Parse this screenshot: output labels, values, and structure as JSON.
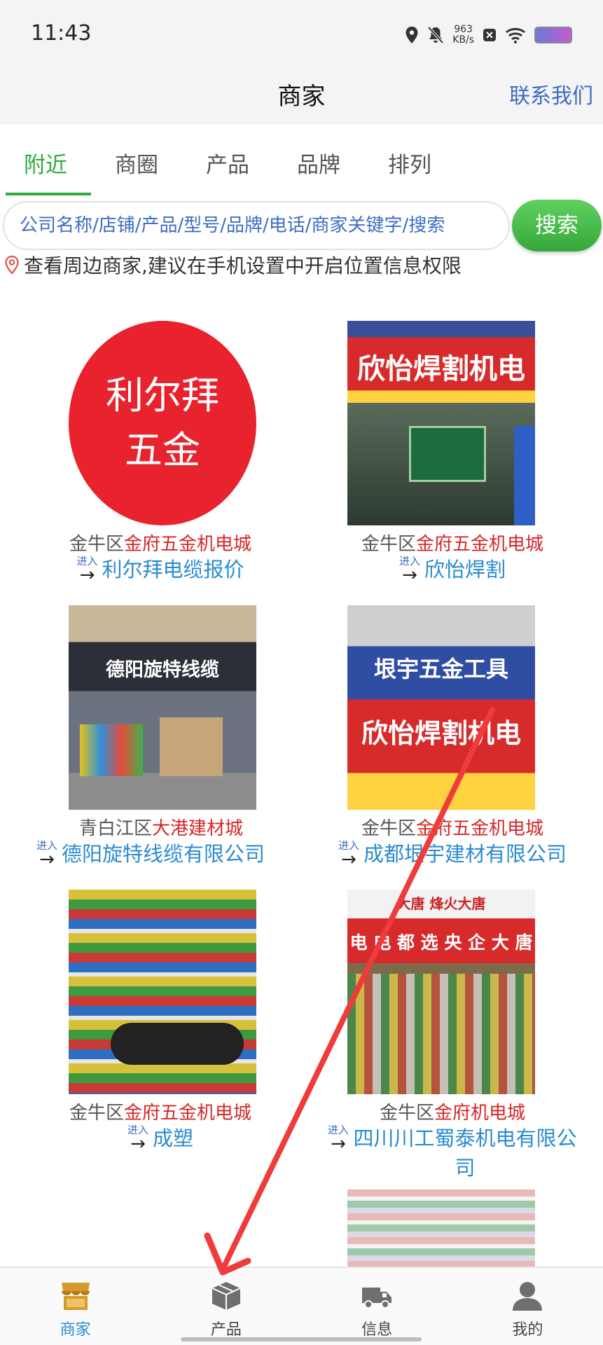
{
  "status_bar": {
    "time": "11:43",
    "speed_value": "963",
    "speed_unit": "KB/s"
  },
  "nav": {
    "title": "商家",
    "contact_label": "联系我们"
  },
  "tabs": [
    {
      "label": "附近",
      "active": true
    },
    {
      "label": "商圈",
      "active": false
    },
    {
      "label": "产品",
      "active": false
    },
    {
      "label": "品牌",
      "active": false
    },
    {
      "label": "排列",
      "active": false
    }
  ],
  "search": {
    "placeholder": "公司名称/店铺/产品/型号/品牌/电话/商家关键字/搜索",
    "button_label": "搜索"
  },
  "location_tip": "查看周边商家,建议在手机设置中开启位置信息权限",
  "enter_label": "进入",
  "merchants": [
    {
      "district": "金牛区",
      "market": "金府五金机电城",
      "name": "利尔拜电缆报价",
      "logo_line1": "利尔拜",
      "logo_line2": "五金"
    },
    {
      "district": "金牛区",
      "market": "金府五金机电城",
      "name": "欣怡焊割",
      "sign": "欣怡焊割机电"
    },
    {
      "district": "青白江区",
      "market": "大港建材城",
      "name": "德阳旋特线缆有限公司",
      "sign": "德阳旋特线缆"
    },
    {
      "district": "金牛区",
      "market": "金府五金机电城",
      "name": "成都垠宇建材有限公司",
      "sign": "垠宇五金工具",
      "sign2": "欣怡焊割机电"
    },
    {
      "district": "金牛区",
      "market": "金府五金机电城",
      "name": "成塑"
    },
    {
      "district": "金牛区",
      "market": "金府机电城",
      "name": "四川川工蜀泰机电有限公司",
      "sign": "电 电 都 选 央 企 大 唐",
      "sign_top": "大唐 烽火大唐"
    }
  ],
  "tabbar": [
    {
      "label": "商家",
      "active": true
    },
    {
      "label": "产品",
      "active": false
    },
    {
      "label": "信息",
      "active": false
    },
    {
      "label": "我的",
      "active": false
    }
  ],
  "colors": {
    "accent_green": "#2faa3c",
    "link_blue": "#2b8bd0",
    "market_red": "#d32727",
    "annotation_arrow": "#ef3b3b"
  }
}
